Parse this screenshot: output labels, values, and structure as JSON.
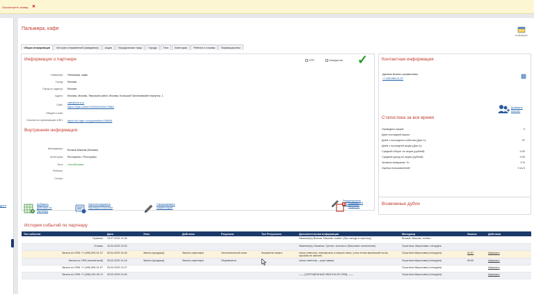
{
  "topbar": {
    "link": "Просмотреть заявку",
    "close": "✕"
  },
  "leftstrip": {
    "link": "дрен"
  },
  "page": {
    "title": "Пальмира, кафе",
    "calendar_label": "КАЛЕНДАРЬ"
  },
  "tabs": [
    "Общая информация",
    "История отправлений (заведения)",
    "Акции",
    "Юридические лица",
    "Города",
    "Теги",
    "Категории",
    "Рейтинг и отзывы",
    "Взаиморасчеты"
  ],
  "partner": {
    "heading": "Информация о партнере",
    "lpr": "ЛПР",
    "establishment": "Заведение",
    "rows": [
      {
        "label": "Название:",
        "value": "Пальмира, кафе",
        "link": false
      },
      {
        "label": "Город:",
        "value": "Москва",
        "link": false
      },
      {
        "label": "Город по адресу:",
        "value": "Москва",
        "link": false
      },
      {
        "label": "Адрес:",
        "value": "Москва, Москва, Тверской район, Москва, Большой Путинковский переулок, 1",
        "link": false
      },
      {
        "label": "Сайт:",
        "value": "cafe@mirra.ru",
        "link": true
      },
      {
        "label": "",
        "value": "https://2gis.ru/firm/70000001026175861",
        "link": true
      },
      {
        "label": "Общий e-mail:",
        "value": "",
        "link": false
      },
      {
        "label": "Ссылка на организацию в BC:",
        "value": "https://bc.bigln.ru/organization/239836",
        "link": true
      }
    ]
  },
  "internal": {
    "heading": "Внутренняя информация",
    "rows": [
      {
        "label": "Менеджеры:",
        "value": "Волков Максим (Москва)"
      },
      {
        "label": "Категории:",
        "value": "Рестораны / Рестораны"
      },
      {
        "label": "Теги:",
        "value": "Сеть/Филиал,"
      },
      {
        "label": "Рейтинг:",
        "value": ""
      },
      {
        "label": "Статус:",
        "value": ""
      }
    ],
    "edit_label": "Редактировать информацию"
  },
  "contact": {
    "heading": "Контактная информация",
    "source": "Данные Бизнес-справочника",
    "phone": "+7 495 699-01-07",
    "add_contact": "Добавить контакт"
  },
  "stats": {
    "heading": "Статистика за все время",
    "rows": [
      {
        "label": "Проведено акций:",
        "value": "0"
      },
      {
        "label": "Дата последней акции:",
        "value": ""
      },
      {
        "label": "Дней с последнего события (Дни С):",
        "value": "97"
      },
      {
        "label": "Дней с последней акции (Дни А):",
        "value": ""
      },
      {
        "label": "Средний оборот по акции (рублей):",
        "value": "0.00"
      },
      {
        "label": "Средний доход по акции (рублей):",
        "value": "0.00"
      },
      {
        "label": "Уровень возвратов, %:",
        "value": "0 %"
      },
      {
        "label": "Оценка пользователей:",
        "value": "0 из 5"
      }
    ]
  },
  "actions": {
    "add_promo": "Добавить действие по партнеру",
    "register": "Зарегистрировать партнера в Биллинг",
    "create_comment": "Сформировать комментарий",
    "report": "Сообщить в вопросах"
  },
  "dupes": {
    "heading": "Возможные дубли"
  },
  "history": {
    "heading": "История событий по партнеру",
    "columns": [
      "Тип события",
      "Дата",
      "Этап",
      "Действие",
      "Результат",
      "Тип Результата",
      "Дополнительная информация",
      "Менеджер",
      "Звонок",
      "Действия"
    ],
    "rows": [
      [
        "Правили",
        "15.07.2025 13:36",
        "",
        "",
        "",
        "",
        "Изменил(а) Волков, Максим, тлойи» (При заходе в карточку)",
        "Волков, Максим, тлойи»",
        "",
        ""
      ],
      [
        "Отказы",
        "10.04.2025 13:03",
        "",
        "",
        "",
        "",
        "Изменил(а) Османов, Султан, sozmarov (Массовое отключение)",
        "Отрытина, Мирослава, mmrygina",
        "",
        ""
      ],
      [
        "Звонок из CRM +7 (495) 699-01-07",
        "09.04.2025 16:46",
        "Звонок (продажа)",
        "Звонок секретарю",
        "Окончательный отказ",
        "Конкретна нашел",
        "ольга ответила, перезвонить в начале июня, у них летом маленький поток, прозьба не звонить",
        "Отрытина Мирослава (mmrygina)",
        "02:57",
        "Изменить"
      ],
      [
        "Звонок из CRM (неответный)",
        "25.03.2025 14:18",
        "Звонок (продажа)",
        "Звонок секретарю",
        "Перезвонить",
        "",
        "ольга ответила – упри завтра",
        "Отрытина Мирослава (mmrygina)",
        "00:00",
        "Изменить"
      ],
      [
        "Звонок из CRM +7 (495) 699-01-07",
        "25.03.2025 13:27",
        "",
        "",
        "",
        "",
        "",
        "Отрытина Мирослава (mmrygina)",
        "",
        "Изменить"
      ],
      [
        "Звонок из CRM +7 (495) 294-35-74",
        "25.03.2025 13:26",
        "",
        "",
        "",
        "",
        "—— [СБРОШЕННЫЙ ЗВОНОК ИЗ CRM] ——",
        "Отрытина Мирослава (mmrygina)",
        "",
        "Изменить"
      ]
    ]
  },
  "colors": {
    "accent": "#c0392b",
    "header": "#1c3a69",
    "link": "#1a5ea8",
    "check": "#1d9a1d"
  }
}
